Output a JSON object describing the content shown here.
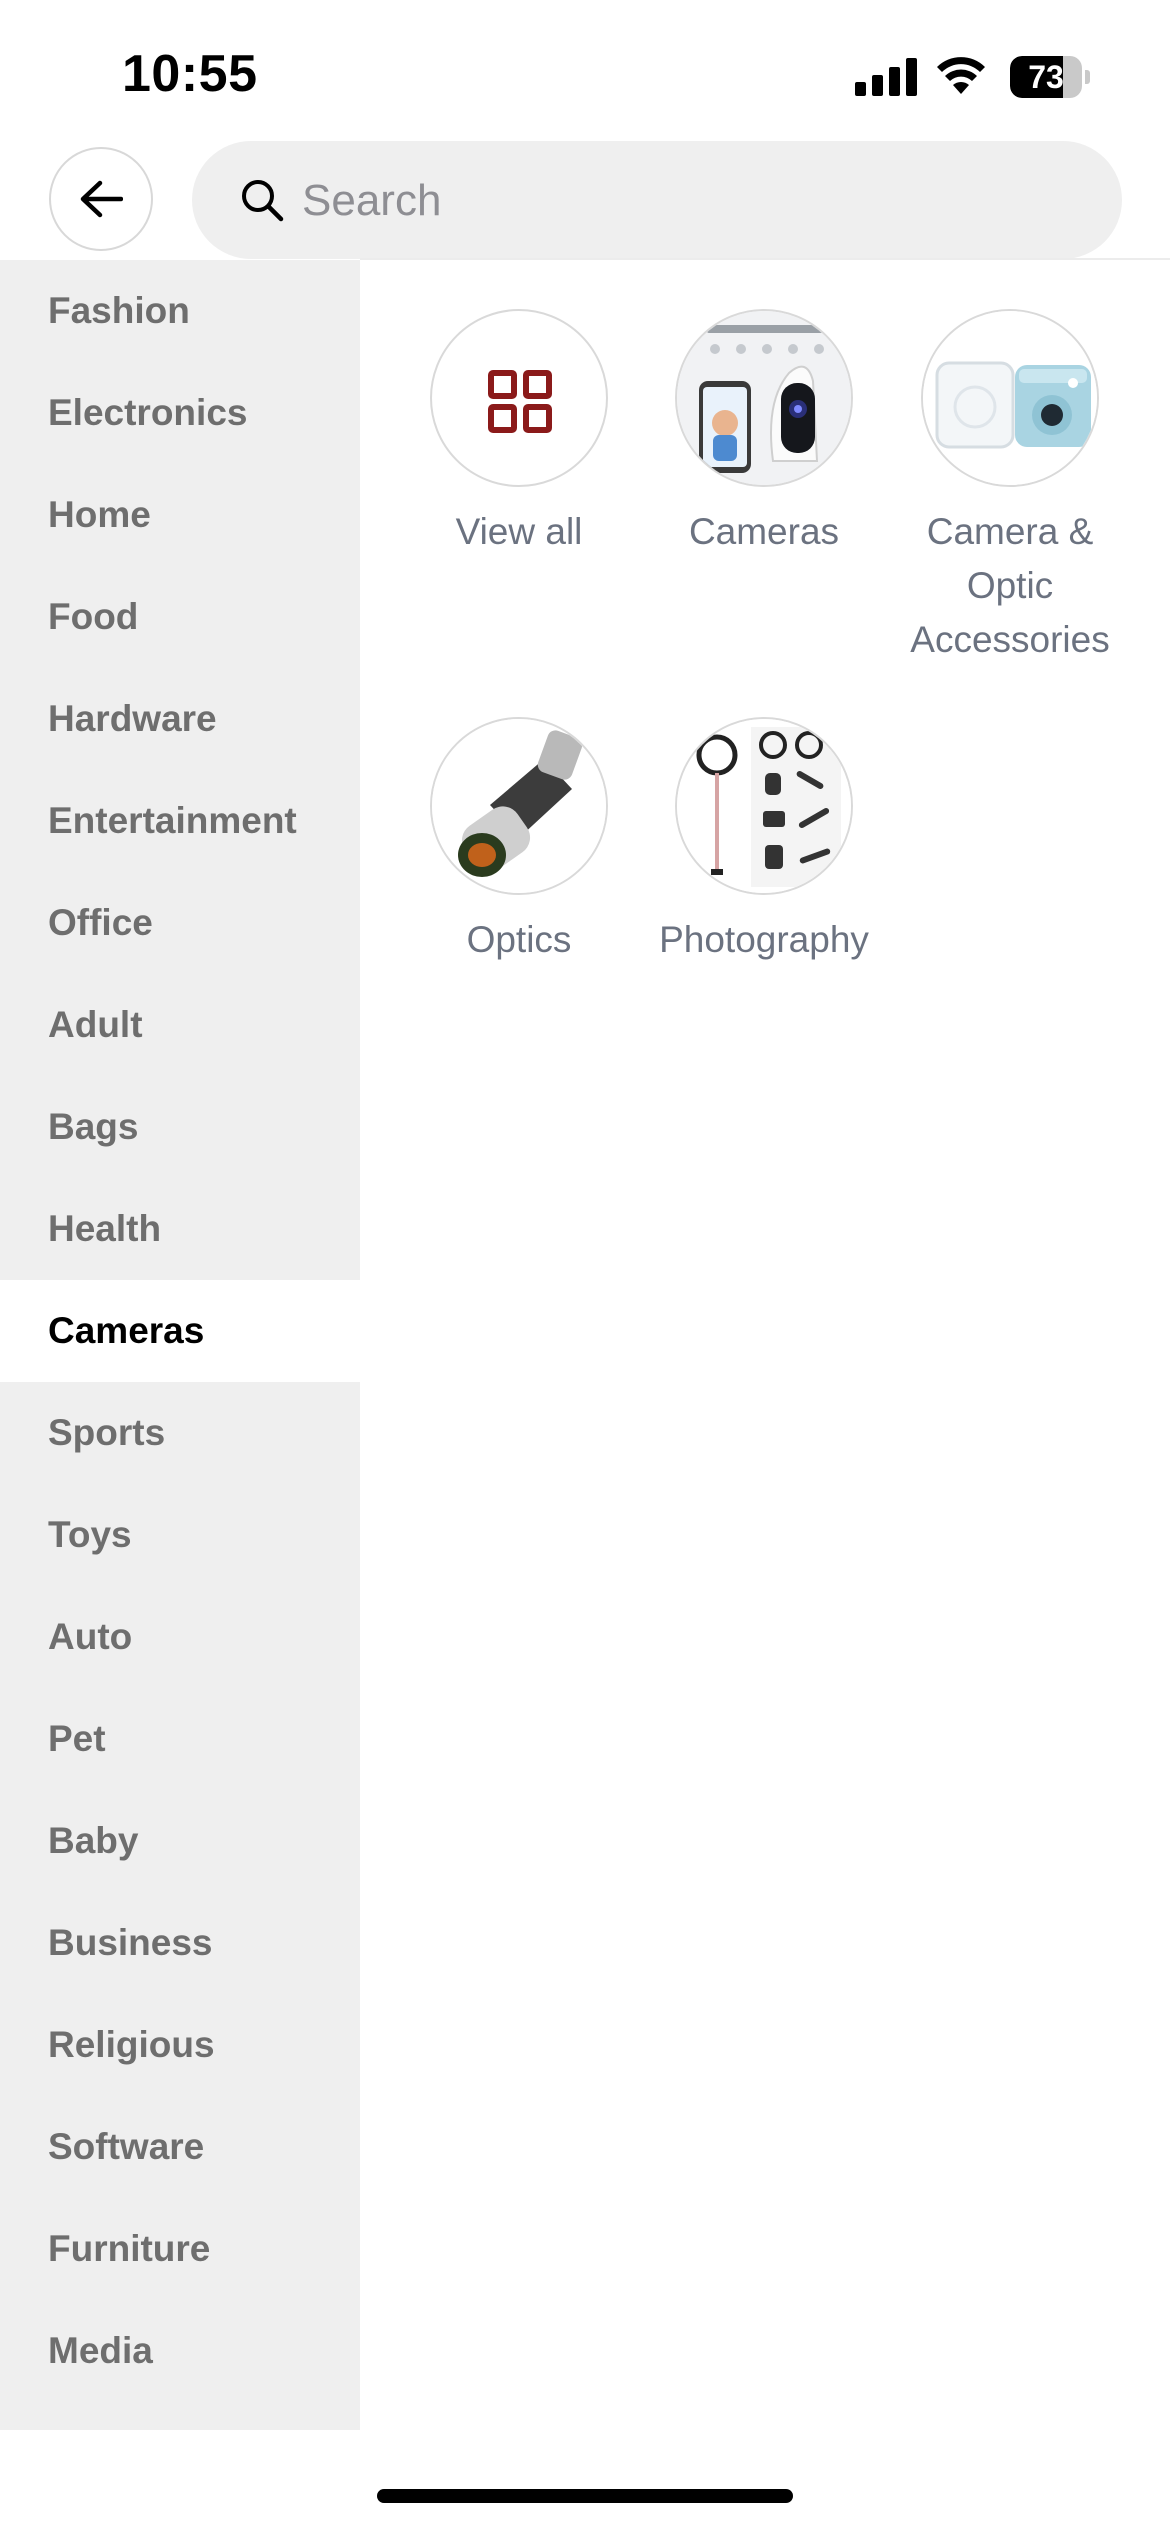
{
  "status_bar": {
    "time": "10:55",
    "battery": "73",
    "battery_level": 0.73
  },
  "header": {
    "back_icon": "arrow-left-icon",
    "search": {
      "placeholder": "Search",
      "value": ""
    }
  },
  "sidebar": {
    "items": [
      {
        "label": "Fashion"
      },
      {
        "label": "Electronics"
      },
      {
        "label": "Home"
      },
      {
        "label": "Food"
      },
      {
        "label": "Hardware"
      },
      {
        "label": "Entertainment"
      },
      {
        "label": "Office"
      },
      {
        "label": "Adult"
      },
      {
        "label": "Bags"
      },
      {
        "label": "Health"
      },
      {
        "label": "Cameras",
        "active": true
      },
      {
        "label": "Sports"
      },
      {
        "label": "Toys"
      },
      {
        "label": "Auto"
      },
      {
        "label": "Pet"
      },
      {
        "label": "Baby"
      },
      {
        "label": "Business"
      },
      {
        "label": "Religious"
      },
      {
        "label": "Software"
      },
      {
        "label": "Furniture"
      },
      {
        "label": "Media"
      }
    ]
  },
  "subcategories": [
    {
      "label": "View all",
      "icon": "grid-icon"
    },
    {
      "label": "Cameras",
      "image": "security-camera-image"
    },
    {
      "label": "Camera & Optic Accessories",
      "image": "instant-camera-case-image"
    },
    {
      "label": "Optics",
      "image": "monocular-image"
    },
    {
      "label": "Photography",
      "image": "photography-kit-image"
    }
  ],
  "colors": {
    "accent": "#8b1a1a",
    "sidebar_bg": "#efefef",
    "label_gray": "#6b7280"
  }
}
